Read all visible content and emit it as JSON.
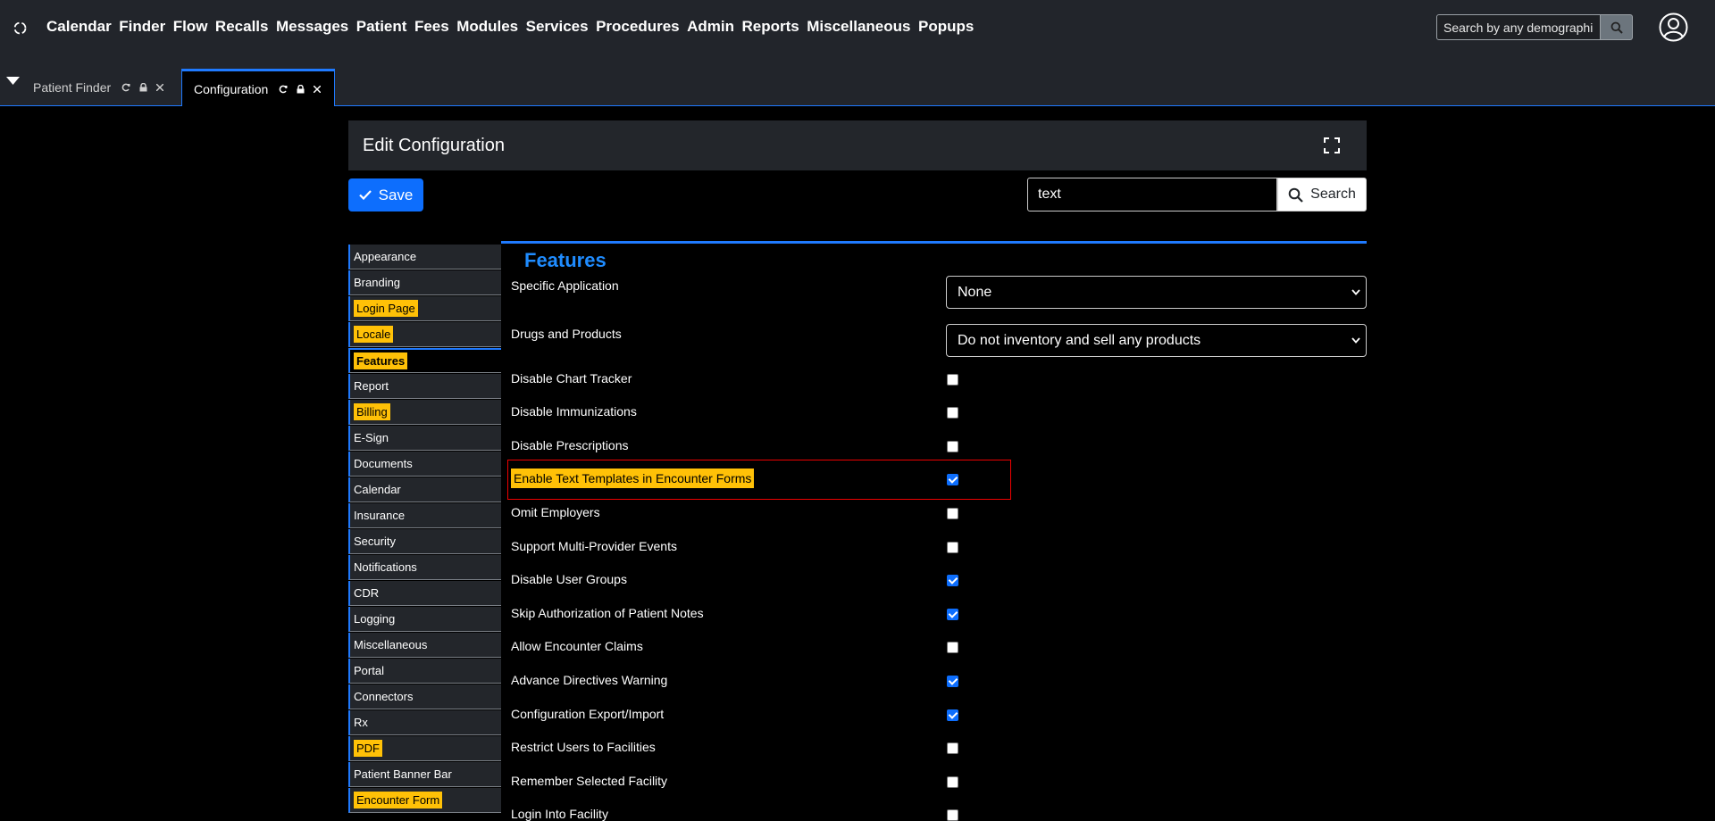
{
  "nav": {
    "menu": [
      "Calendar",
      "Finder",
      "Flow",
      "Recalls",
      "Messages",
      "Patient",
      "Fees",
      "Modules",
      "Services",
      "Procedures",
      "Admin",
      "Reports",
      "Miscellaneous",
      "Popups"
    ],
    "search_placeholder": "Search by any demographics"
  },
  "tabs": [
    {
      "label": "Patient Finder",
      "active": false
    },
    {
      "label": "Configuration",
      "active": true
    }
  ],
  "card": {
    "title": "Edit Configuration"
  },
  "toolbar": {
    "save_label": "Save",
    "search_value": "text",
    "search_label": "Search"
  },
  "sidebar": {
    "items": [
      {
        "label": "Appearance",
        "highlighted": false
      },
      {
        "label": "Branding",
        "highlighted": false
      },
      {
        "label": "Login Page",
        "highlighted": true
      },
      {
        "label": "Locale",
        "highlighted": true
      },
      {
        "label": "Features",
        "highlighted": true,
        "active": true
      },
      {
        "label": "Report",
        "highlighted": false
      },
      {
        "label": "Billing",
        "highlighted": true
      },
      {
        "label": "E-Sign",
        "highlighted": false
      },
      {
        "label": "Documents",
        "highlighted": false
      },
      {
        "label": "Calendar",
        "highlighted": false
      },
      {
        "label": "Insurance",
        "highlighted": false
      },
      {
        "label": "Security",
        "highlighted": false
      },
      {
        "label": "Notifications",
        "highlighted": false
      },
      {
        "label": "CDR",
        "highlighted": false
      },
      {
        "label": "Logging",
        "highlighted": false
      },
      {
        "label": "Miscellaneous",
        "highlighted": false
      },
      {
        "label": "Portal",
        "highlighted": false
      },
      {
        "label": "Connectors",
        "highlighted": false
      },
      {
        "label": "Rx",
        "highlighted": false
      },
      {
        "label": "PDF",
        "highlighted": true
      },
      {
        "label": "Patient Banner Bar",
        "highlighted": false
      },
      {
        "label": "Encounter Form",
        "highlighted": true
      }
    ]
  },
  "section": {
    "title": "Features"
  },
  "settings": {
    "selects": [
      {
        "label": "Specific Application",
        "value": "None"
      },
      {
        "label": "Drugs and Products",
        "value": "Do not inventory and sell any products"
      }
    ],
    "checkboxes": [
      {
        "label": "Disable Chart Tracker",
        "checked": false
      },
      {
        "label": "Disable Immunizations",
        "checked": false
      },
      {
        "label": "Disable Prescriptions",
        "checked": false
      },
      {
        "label": "Enable Text Templates in Encounter Forms",
        "checked": true,
        "highlighted": true
      },
      {
        "label": "Omit Employers",
        "checked": false
      },
      {
        "label": "Support Multi-Provider Events",
        "checked": false
      },
      {
        "label": "Disable User Groups",
        "checked": true
      },
      {
        "label": "Skip Authorization of Patient Notes",
        "checked": true
      },
      {
        "label": "Allow Encounter Claims",
        "checked": false
      },
      {
        "label": "Advance Directives Warning",
        "checked": true
      },
      {
        "label": "Configuration Export/Import",
        "checked": true
      },
      {
        "label": "Restrict Users to Facilities",
        "checked": false
      },
      {
        "label": "Remember Selected Facility",
        "checked": false
      },
      {
        "label": "Login Into Facility",
        "checked": false
      }
    ]
  },
  "colors": {
    "accent": "#1f7aff",
    "highlight": "#ffc107",
    "primary_button": "#0d6efd",
    "panel": "#23262b"
  }
}
